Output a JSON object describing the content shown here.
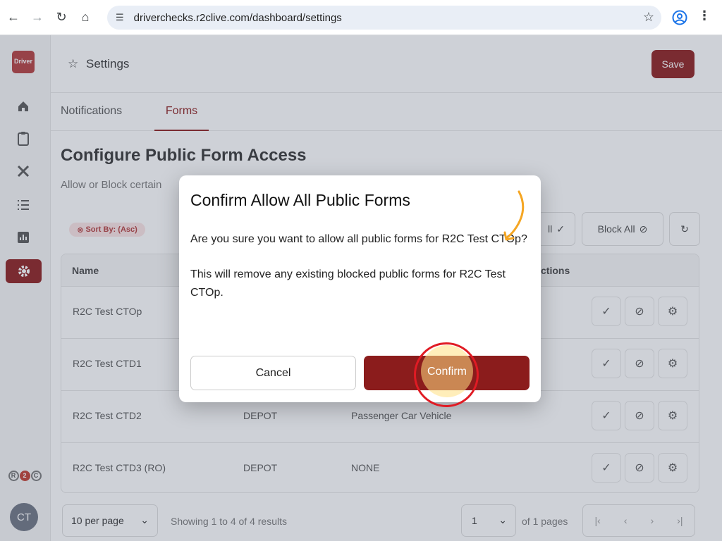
{
  "browser": {
    "url": "driverchecks.r2clive.com/dashboard/settings"
  },
  "sidebar": {
    "logo_text": "Driver",
    "bottom_logo": [
      "R",
      "2",
      "C"
    ],
    "avatar_initials": "CT"
  },
  "header": {
    "title": "Settings",
    "save_label": "Save"
  },
  "tabs": [
    {
      "label": "Notifications",
      "active": false
    },
    {
      "label": "Forms",
      "active": true
    }
  ],
  "section": {
    "title": "Configure Public Form Access",
    "subtitle": "Allow or Block certain"
  },
  "toolbar": {
    "sort_label": "Sort By: (Asc)",
    "allow_all_label": "ll",
    "block_all_label": "Block All"
  },
  "table": {
    "headers": [
      "Name",
      "ctions"
    ],
    "rows": [
      {
        "name": "R2C Test CTOp",
        "type": "",
        "vehicle": ""
      },
      {
        "name": "R2C Test CTD1",
        "type": "",
        "vehicle": ""
      },
      {
        "name": "R2C Test CTD2",
        "type": "DEPOT",
        "vehicle": "Passenger Car Vehicle"
      },
      {
        "name": "R2C Test CTD3 (RO)",
        "type": "DEPOT",
        "vehicle": "NONE"
      }
    ]
  },
  "footer": {
    "per_page": "10 per page",
    "showing": "Showing 1 to 4 of 4 results",
    "page": "1",
    "of_pages": "of 1 pages"
  },
  "modal": {
    "title": "Confirm Allow All Public Forms",
    "message1": "Are you sure you want to allow all public forms for R2C Test CTOp?",
    "message2": "This will remove any existing blocked public forms for R2C Test CTOp.",
    "cancel_label": "Cancel",
    "confirm_label": "Confirm"
  },
  "colors": {
    "brand": "#8b1a1a",
    "highlight_ring": "#e01b24",
    "arrow": "#f5a623"
  }
}
